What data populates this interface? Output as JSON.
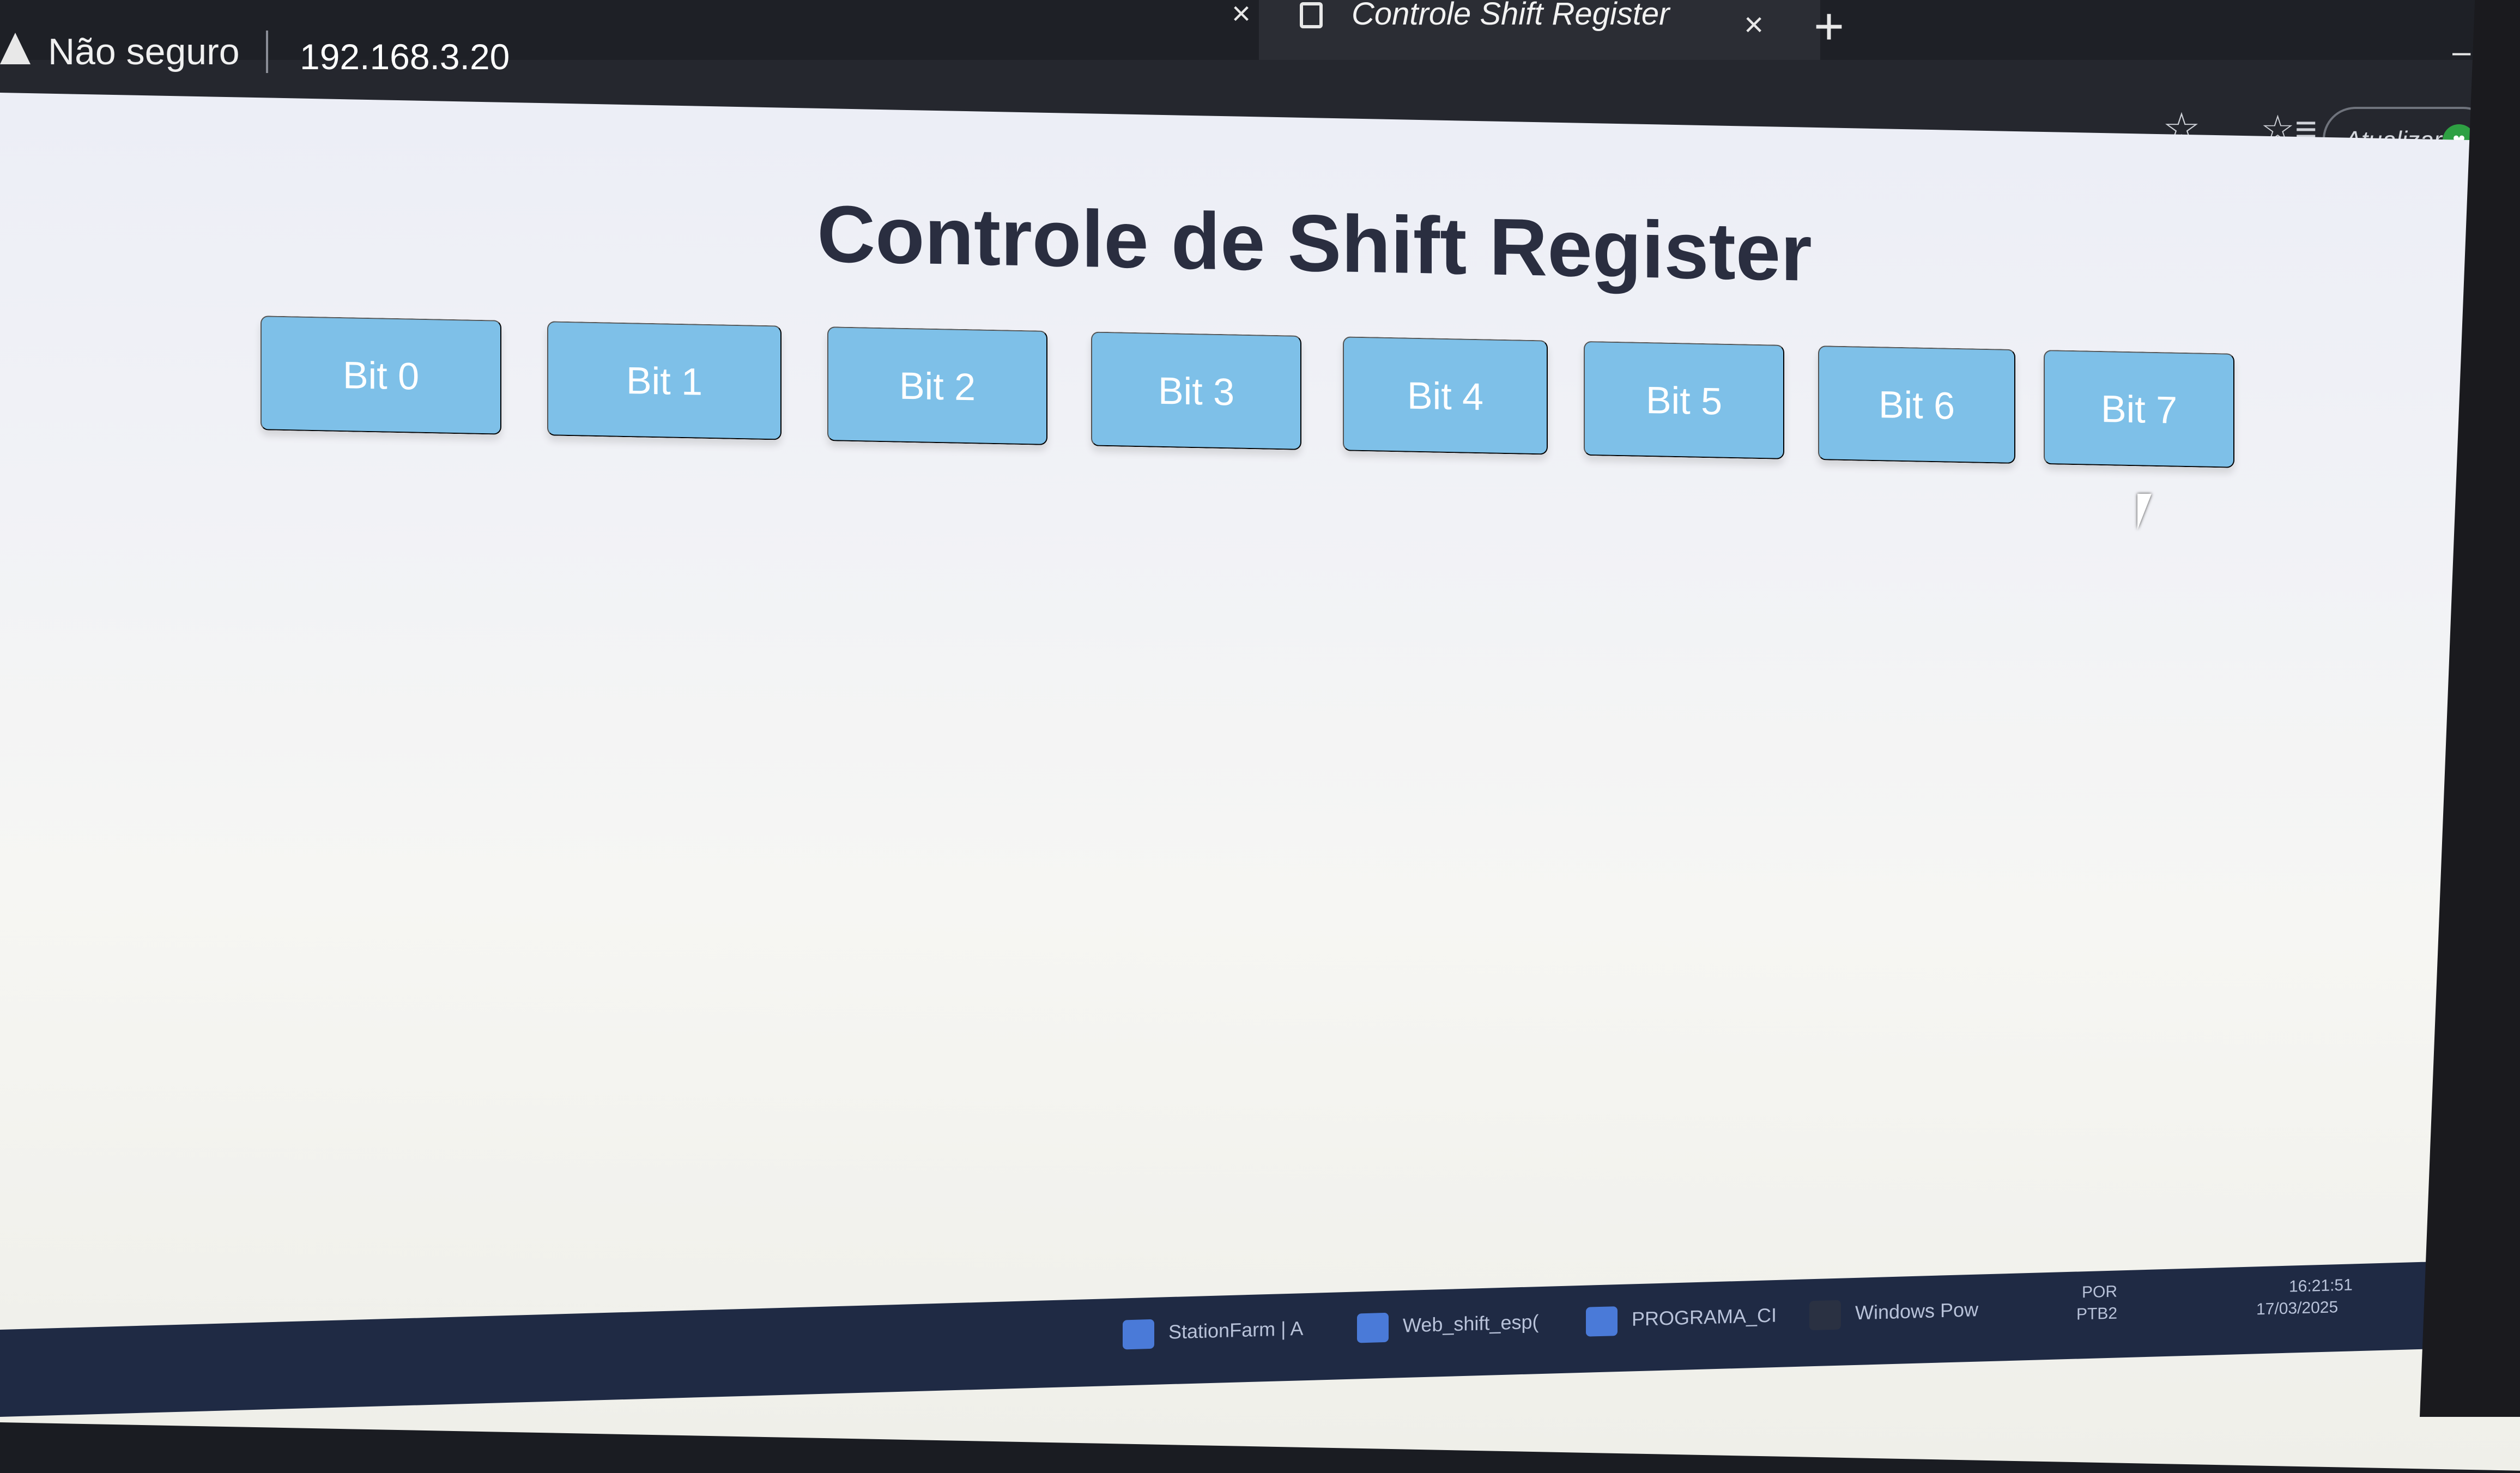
{
  "browser": {
    "tab_title": "Controle Shift Register",
    "tab_close": "×",
    "prev_tab_close": "×",
    "new_tab": "+",
    "minimize": "–",
    "security_label": "Não seguro",
    "url": "192.168.3.20",
    "update_label": "Atualizar"
  },
  "page": {
    "title": "Controle de Shift Register",
    "bits": [
      "Bit 0",
      "Bit 1",
      "Bit 2",
      "Bit 3",
      "Bit 4",
      "Bit 5",
      "Bit 6",
      "Bit 7"
    ],
    "button_color": "#7ec0e8"
  },
  "taskbar": {
    "items": [
      "StationFarm | A",
      "Web_shift_esp(",
      "PROGRAMA_CI",
      "Windows Pow"
    ],
    "language": "POR",
    "keyboard": "PTB2",
    "time": "16:21:51",
    "date": "17/03/2025"
  }
}
